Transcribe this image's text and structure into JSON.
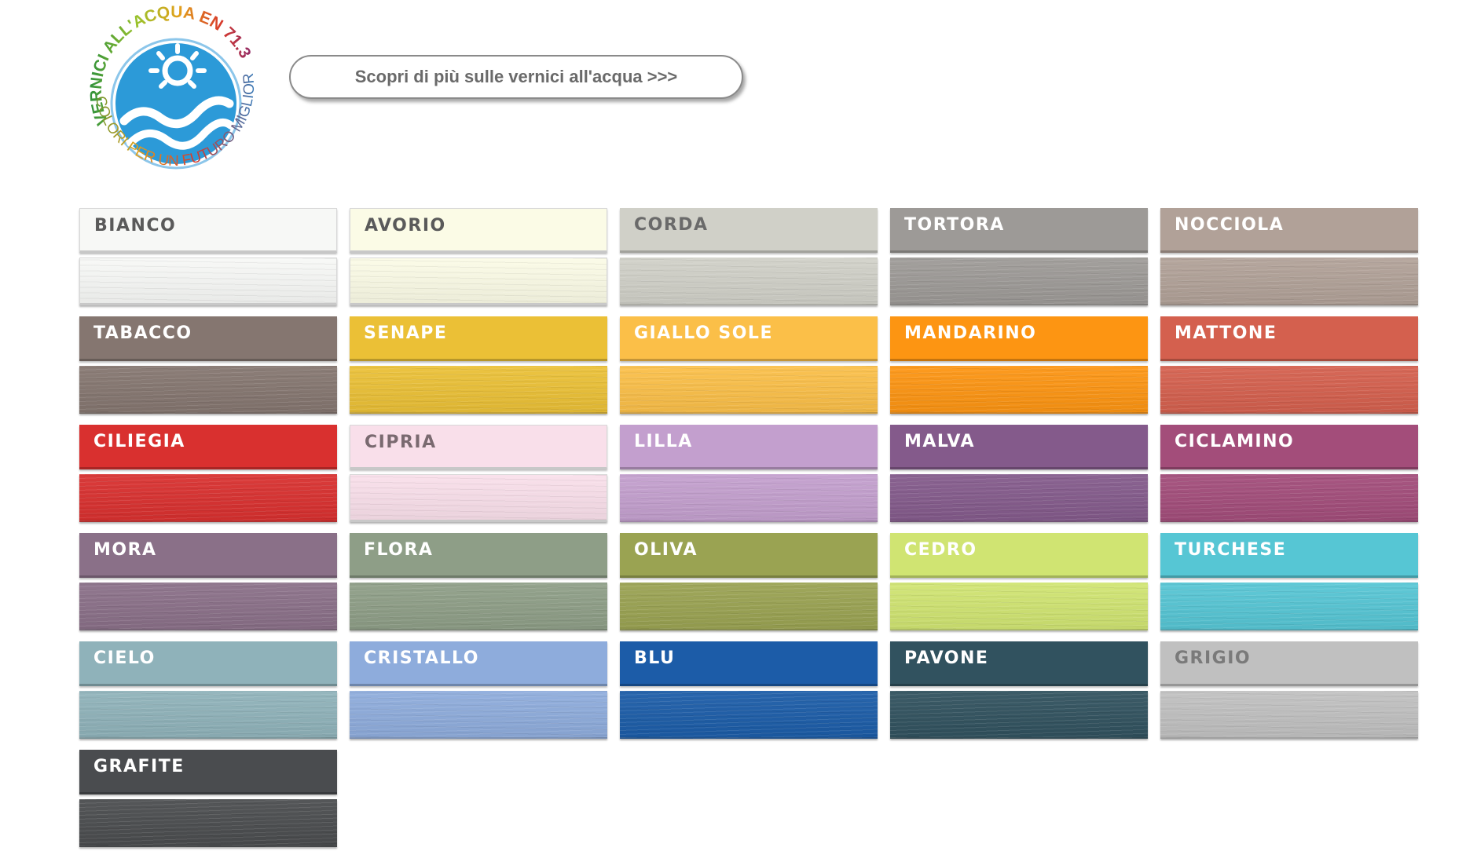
{
  "logo": {
    "text_top": "VERNICI ALL'ACQUA EN 71.3",
    "text_bottom": "COLORI PER UN FUTURO MIGLIORE",
    "color_primary": "#2c9ad8"
  },
  "cta": {
    "label": "Scopri di più sulle vernici all'acqua >>>"
  },
  "swatches": [
    {
      "name": "BIANCO",
      "color": "#f7f8f6",
      "text": "#5a5a5a"
    },
    {
      "name": "AVORIO",
      "color": "#fbfbe6",
      "text": "#5a5a5a"
    },
    {
      "name": "CORDA",
      "color": "#d0d0c8",
      "text": "#6a6a6a"
    },
    {
      "name": "TORTORA",
      "color": "#9d9a97",
      "text": "#ffffff"
    },
    {
      "name": "NOCCIOLA",
      "color": "#b1a198",
      "text": "#ffffff"
    },
    {
      "name": "TABACCO",
      "color": "#857670",
      "text": "#ffffff"
    },
    {
      "name": "SENAPE",
      "color": "#ebc036",
      "text": "#ffffff"
    },
    {
      "name": "GIALLO SOLE",
      "color": "#fbbf48",
      "text": "#ffffff"
    },
    {
      "name": "MANDARINO",
      "color": "#fd9512",
      "text": "#ffffff"
    },
    {
      "name": "MATTONE",
      "color": "#d4604e",
      "text": "#ffffff"
    },
    {
      "name": "CILIEGIA",
      "color": "#d9302f",
      "text": "#ffffff"
    },
    {
      "name": "CIPRIA",
      "color": "#f9dfea",
      "text": "#7a6a70"
    },
    {
      "name": "LILLA",
      "color": "#c39fce",
      "text": "#ffffff"
    },
    {
      "name": "MALVA",
      "color": "#845a8b",
      "text": "#ffffff"
    },
    {
      "name": "CICLAMINO",
      "color": "#a34d7a",
      "text": "#ffffff"
    },
    {
      "name": "MORA",
      "color": "#8a7088",
      "text": "#ffffff"
    },
    {
      "name": "FLORA",
      "color": "#8e9e87",
      "text": "#ffffff"
    },
    {
      "name": "OLIVA",
      "color": "#9aa352",
      "text": "#ffffff"
    },
    {
      "name": "CEDRO",
      "color": "#d0e472",
      "text": "#ffffff"
    },
    {
      "name": "TURCHESE",
      "color": "#56c6d4",
      "text": "#ffffff"
    },
    {
      "name": "CIELO",
      "color": "#8fb2ba",
      "text": "#ffffff"
    },
    {
      "name": "CRISTALLO",
      "color": "#8eacdc",
      "text": "#ffffff"
    },
    {
      "name": "BLU",
      "color": "#1c5ca8",
      "text": "#ffffff"
    },
    {
      "name": "PAVONE",
      "color": "#31525f",
      "text": "#ffffff"
    },
    {
      "name": "GRIGIO",
      "color": "#c0c0c0",
      "text": "#7a7a7a"
    },
    {
      "name": "GRAFITE",
      "color": "#4a4c4f",
      "text": "#ffffff"
    }
  ]
}
